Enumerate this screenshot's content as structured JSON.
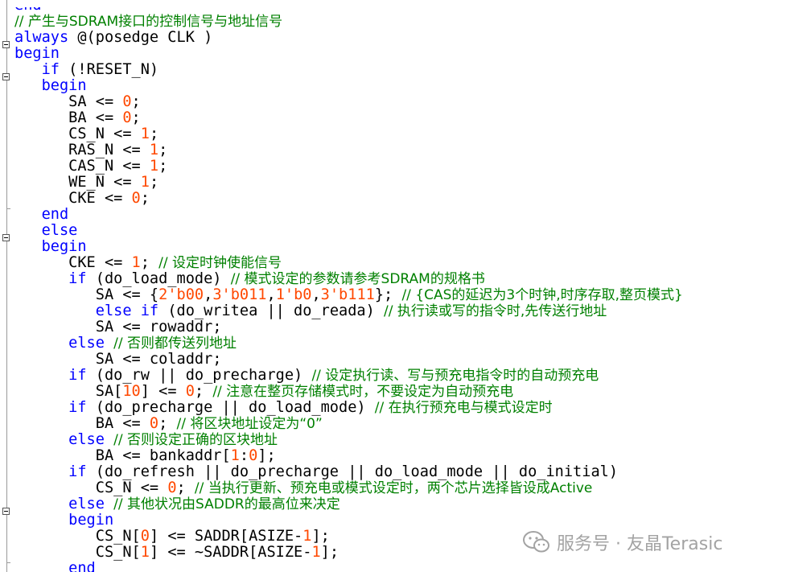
{
  "editor": {
    "language": "Verilog",
    "lines": [
      {
        "tokens": [
          {
            "t": "end",
            "c": "kw"
          }
        ]
      },
      {
        "tokens": [
          {
            "t": "// 产生与SDRAM接口的控制信号与地址信号",
            "c": "cm"
          }
        ]
      },
      {
        "tokens": [
          {
            "t": "always",
            "c": "kw"
          },
          {
            "t": " @(posedge CLK )",
            "c": ""
          }
        ]
      },
      {
        "tokens": [
          {
            "t": "begin",
            "c": "kw"
          }
        ]
      },
      {
        "tokens": [
          {
            "t": "   ",
            "c": ""
          },
          {
            "t": "if",
            "c": "kw"
          },
          {
            "t": " (!RESET_N)",
            "c": ""
          }
        ]
      },
      {
        "tokens": [
          {
            "t": "   ",
            "c": ""
          },
          {
            "t": "begin",
            "c": "kw"
          }
        ]
      },
      {
        "tokens": [
          {
            "t": "      SA <= ",
            "c": ""
          },
          {
            "t": "0",
            "c": "num"
          },
          {
            "t": ";",
            "c": ""
          }
        ]
      },
      {
        "tokens": [
          {
            "t": "      BA <= ",
            "c": ""
          },
          {
            "t": "0",
            "c": "num"
          },
          {
            "t": ";",
            "c": ""
          }
        ]
      },
      {
        "tokens": [
          {
            "t": "      CS_N <= ",
            "c": ""
          },
          {
            "t": "1",
            "c": "num"
          },
          {
            "t": ";",
            "c": ""
          }
        ]
      },
      {
        "tokens": [
          {
            "t": "      RAS_N <= ",
            "c": ""
          },
          {
            "t": "1",
            "c": "num"
          },
          {
            "t": ";",
            "c": ""
          }
        ]
      },
      {
        "tokens": [
          {
            "t": "      CAS_N <= ",
            "c": ""
          },
          {
            "t": "1",
            "c": "num"
          },
          {
            "t": ";",
            "c": ""
          }
        ]
      },
      {
        "tokens": [
          {
            "t": "      WE_N <= ",
            "c": ""
          },
          {
            "t": "1",
            "c": "num"
          },
          {
            "t": ";",
            "c": ""
          }
        ]
      },
      {
        "tokens": [
          {
            "t": "      CKE <= ",
            "c": ""
          },
          {
            "t": "0",
            "c": "num"
          },
          {
            "t": ";",
            "c": ""
          }
        ]
      },
      {
        "tokens": [
          {
            "t": "   ",
            "c": ""
          },
          {
            "t": "end",
            "c": "kw"
          }
        ]
      },
      {
        "tokens": [
          {
            "t": "   ",
            "c": ""
          },
          {
            "t": "else",
            "c": "kw"
          }
        ]
      },
      {
        "tokens": [
          {
            "t": "   ",
            "c": ""
          },
          {
            "t": "begin",
            "c": "kw"
          }
        ]
      },
      {
        "tokens": [
          {
            "t": "      CKE <= ",
            "c": ""
          },
          {
            "t": "1",
            "c": "num"
          },
          {
            "t": "; ",
            "c": ""
          },
          {
            "t": "// 设定时钟使能信号",
            "c": "cm"
          }
        ]
      },
      {
        "tokens": [
          {
            "t": "      ",
            "c": ""
          },
          {
            "t": "if",
            "c": "kw"
          },
          {
            "t": " (do_load_mode) ",
            "c": ""
          },
          {
            "t": "// 模式设定的参数请参考SDRAM的规格书",
            "c": "cm"
          }
        ]
      },
      {
        "tokens": [
          {
            "t": "         SA <= {",
            "c": ""
          },
          {
            "t": "2'b00",
            "c": "num"
          },
          {
            "t": ",",
            "c": ""
          },
          {
            "t": "3'b011",
            "c": "num"
          },
          {
            "t": ",",
            "c": ""
          },
          {
            "t": "1'b0",
            "c": "num"
          },
          {
            "t": ",",
            "c": ""
          },
          {
            "t": "3'b111",
            "c": "num"
          },
          {
            "t": "}; ",
            "c": ""
          },
          {
            "t": "// {CAS的延迟为3个时钟,时序存取,整页模式}",
            "c": "cm"
          }
        ]
      },
      {
        "tokens": [
          {
            "t": "         ",
            "c": ""
          },
          {
            "t": "else if",
            "c": "kw"
          },
          {
            "t": " (do_writea || do_reada) ",
            "c": ""
          },
          {
            "t": "// 执行读或写的指令时,先传送行地址",
            "c": "cm"
          }
        ]
      },
      {
        "tokens": [
          {
            "t": "         SA <= rowaddr;",
            "c": ""
          }
        ]
      },
      {
        "tokens": [
          {
            "t": "      ",
            "c": ""
          },
          {
            "t": "else",
            "c": "kw"
          },
          {
            "t": " ",
            "c": ""
          },
          {
            "t": "// 否则都传送列地址",
            "c": "cm"
          }
        ]
      },
      {
        "tokens": [
          {
            "t": "         SA <= coladdr;",
            "c": ""
          }
        ]
      },
      {
        "tokens": [
          {
            "t": "      ",
            "c": ""
          },
          {
            "t": "if",
            "c": "kw"
          },
          {
            "t": " (do_rw || do_precharge) ",
            "c": ""
          },
          {
            "t": "// 设定执行读、写与预充电指令时的自动预充电",
            "c": "cm"
          }
        ]
      },
      {
        "tokens": [
          {
            "t": "         SA[",
            "c": ""
          },
          {
            "t": "10",
            "c": "num"
          },
          {
            "t": "] <= ",
            "c": ""
          },
          {
            "t": "0",
            "c": "num"
          },
          {
            "t": "; ",
            "c": ""
          },
          {
            "t": "// 注意在整页存储模式时，不要设定为自动预充电",
            "c": "cm"
          }
        ]
      },
      {
        "tokens": [
          {
            "t": "      ",
            "c": ""
          },
          {
            "t": "if",
            "c": "kw"
          },
          {
            "t": " (do_precharge || do_load_mode) ",
            "c": ""
          },
          {
            "t": "// 在执行预充电与模式设定时",
            "c": "cm"
          }
        ]
      },
      {
        "tokens": [
          {
            "t": "         BA <= ",
            "c": ""
          },
          {
            "t": "0",
            "c": "num"
          },
          {
            "t": "; ",
            "c": ""
          },
          {
            "t": "// 将区块地址设定为“0”",
            "c": "cm"
          }
        ]
      },
      {
        "tokens": [
          {
            "t": "      ",
            "c": ""
          },
          {
            "t": "else",
            "c": "kw"
          },
          {
            "t": " ",
            "c": ""
          },
          {
            "t": "// 否则设定正确的区块地址",
            "c": "cm"
          }
        ]
      },
      {
        "tokens": [
          {
            "t": "         BA <= bankaddr[",
            "c": ""
          },
          {
            "t": "1",
            "c": "num"
          },
          {
            "t": ":",
            "c": ""
          },
          {
            "t": "0",
            "c": "num"
          },
          {
            "t": "];",
            "c": ""
          }
        ]
      },
      {
        "tokens": [
          {
            "t": "      ",
            "c": ""
          },
          {
            "t": "if",
            "c": "kw"
          },
          {
            "t": " (do_refresh || do_precharge || do_load_mode || do_initial)",
            "c": ""
          }
        ]
      },
      {
        "tokens": [
          {
            "t": "         CS_N <= ",
            "c": ""
          },
          {
            "t": "0",
            "c": "num"
          },
          {
            "t": "; ",
            "c": ""
          },
          {
            "t": "// 当执行更新、预充电或模式设定时，两个芯片选择皆设成Active",
            "c": "cm"
          }
        ]
      },
      {
        "tokens": [
          {
            "t": "      ",
            "c": ""
          },
          {
            "t": "else",
            "c": "kw"
          },
          {
            "t": " ",
            "c": ""
          },
          {
            "t": "// 其他状况由SADDR的最高位来决定",
            "c": "cm"
          }
        ]
      },
      {
        "tokens": [
          {
            "t": "      ",
            "c": ""
          },
          {
            "t": "begin",
            "c": "kw"
          }
        ]
      },
      {
        "tokens": [
          {
            "t": "         CS_N[",
            "c": ""
          },
          {
            "t": "0",
            "c": "num"
          },
          {
            "t": "] <= SADDR[ASIZE-",
            "c": ""
          },
          {
            "t": "1",
            "c": "num"
          },
          {
            "t": "];",
            "c": ""
          }
        ]
      },
      {
        "tokens": [
          {
            "t": "         CS_N[",
            "c": ""
          },
          {
            "t": "1",
            "c": "num"
          },
          {
            "t": "] <= ~SADDR[ASIZE-",
            "c": ""
          },
          {
            "t": "1",
            "c": "num"
          },
          {
            "t": "];",
            "c": ""
          }
        ]
      },
      {
        "tokens": [
          {
            "t": "      ",
            "c": ""
          },
          {
            "t": "end",
            "c": "kw"
          }
        ]
      },
      {
        "tokens": [
          {
            "t": "// ",
            "c": "cm"
          }
        ]
      }
    ]
  },
  "watermark": {
    "text": "服务号 · 友晶Terasic",
    "logo_icon": "wechat-logo-icon"
  },
  "colors": {
    "keyword": "#0000ff",
    "number": "#ff4800",
    "comment": "#008000",
    "text": "#000000",
    "background": "#ffffff",
    "watermark": "#a3a3a3"
  }
}
